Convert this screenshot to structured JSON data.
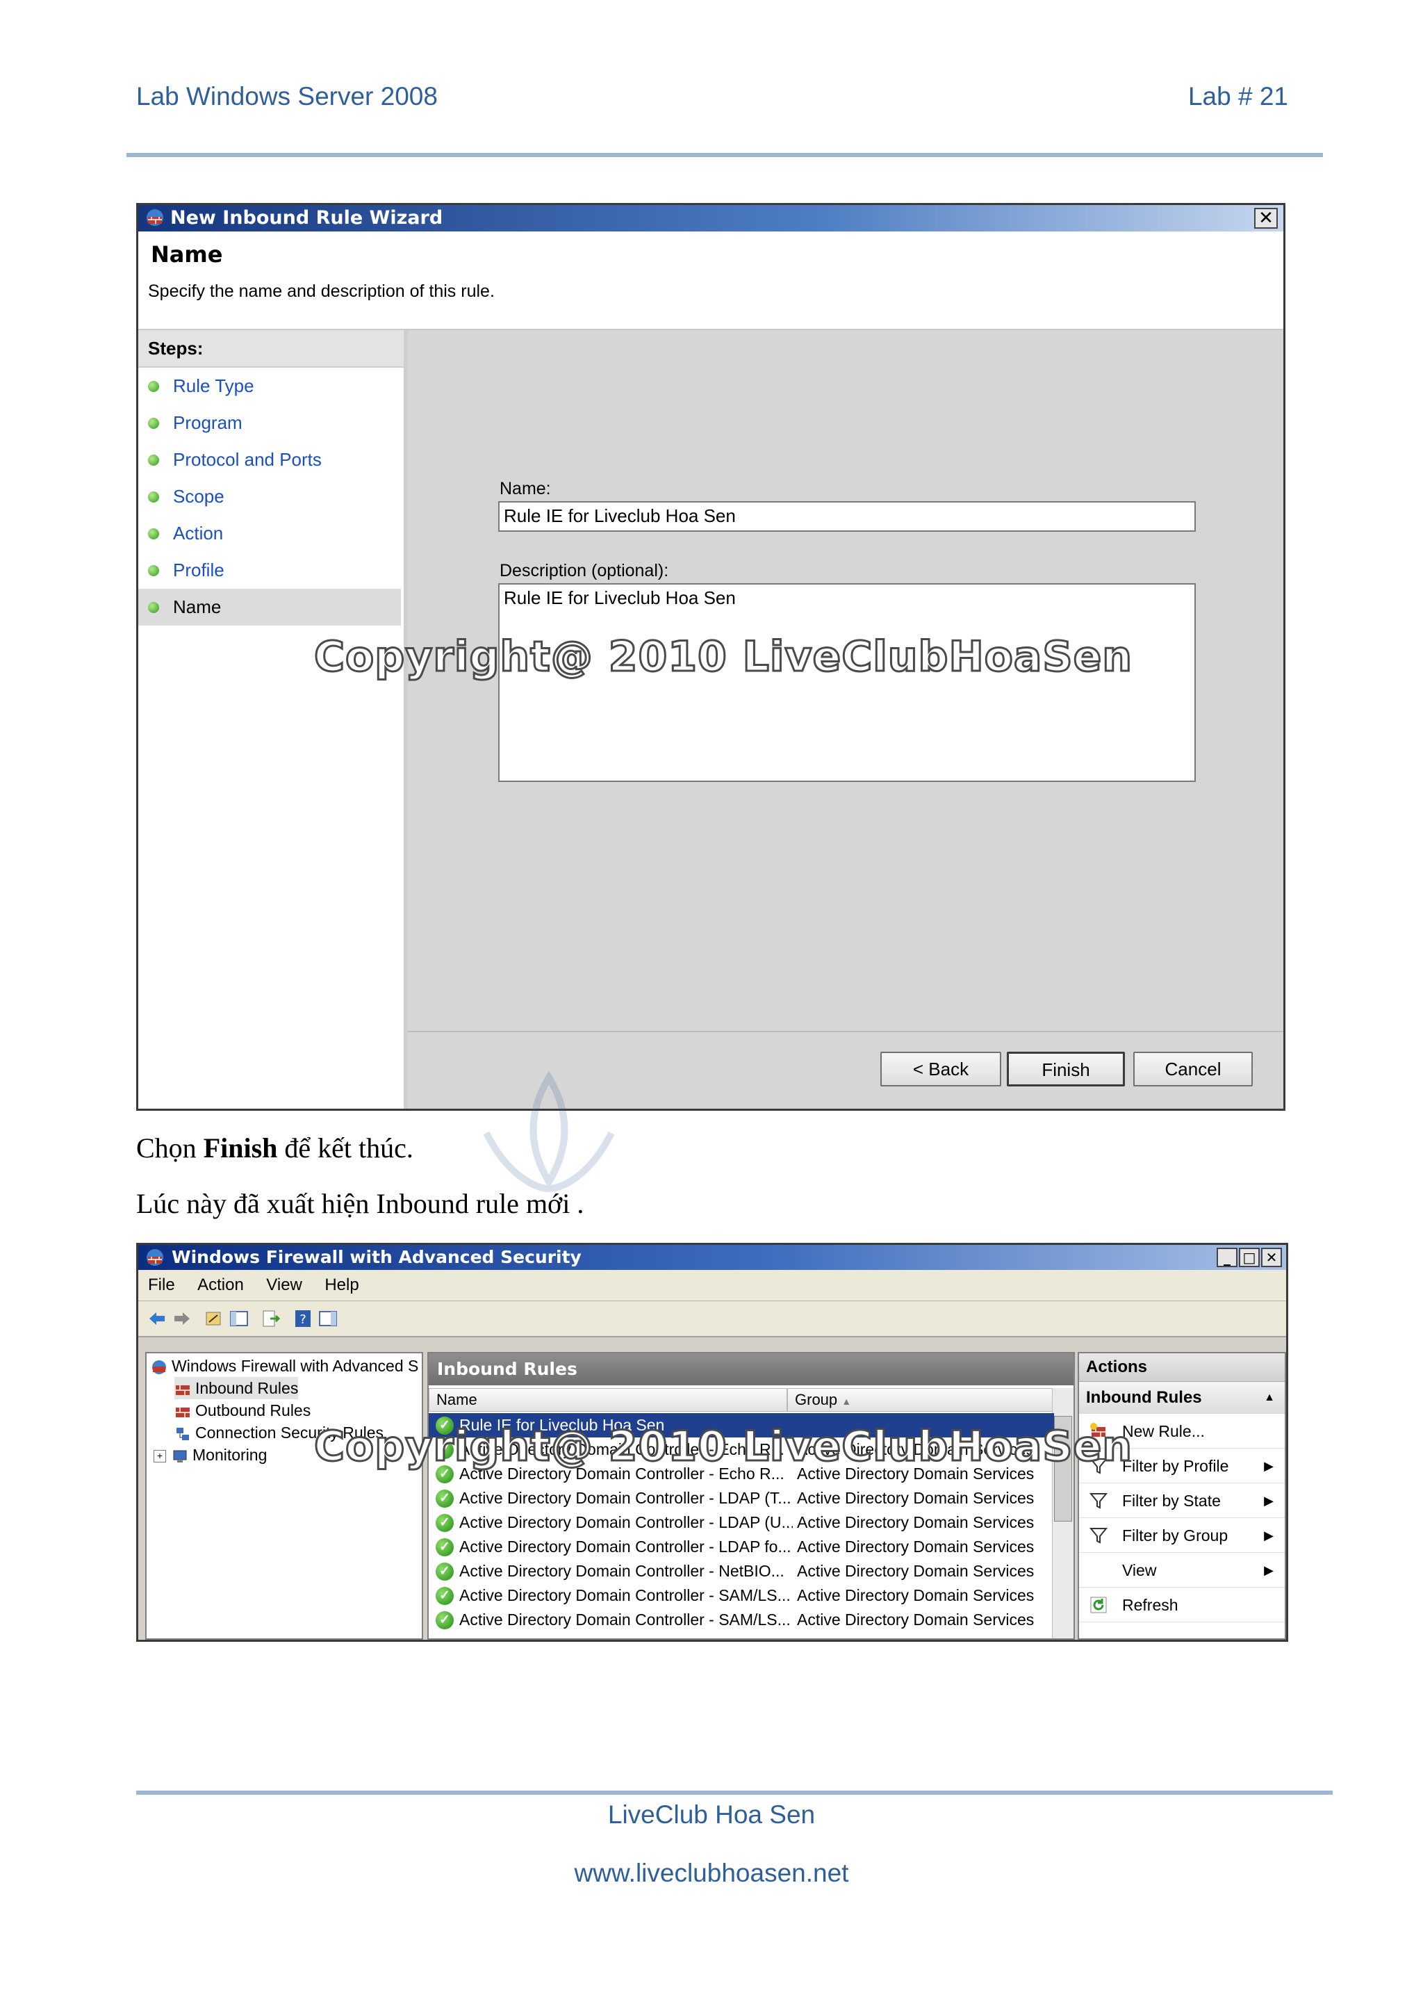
{
  "header": {
    "left": "Lab Windows Server 2008",
    "right": "Lab # 21"
  },
  "wizard": {
    "title": "New Inbound Rule Wizard",
    "close": "✕",
    "heading": "Name",
    "subtitle": "Specify the name and description of this rule.",
    "steps_label": "Steps:",
    "steps": [
      "Rule Type",
      "Program",
      "Protocol and Ports",
      "Scope",
      "Action",
      "Profile",
      "Name"
    ],
    "name_label": "Name:",
    "name_value": "Rule IE for Liveclub Hoa Sen",
    "desc_label": "Description (optional):",
    "desc_value": "Rule IE for Liveclub Hoa Sen",
    "back_label": "< Back",
    "finish_label": "Finish",
    "cancel_label": "Cancel"
  },
  "para1": {
    "before": "Chọn ",
    "bold": "Finish",
    "after": " để kết thúc."
  },
  "para2": "Lúc này đã xuất hiện Inbound rule mới .",
  "firewall": {
    "title": "Windows Firewall with Advanced Security",
    "menus": [
      "File",
      "Action",
      "View",
      "Help"
    ],
    "tree": [
      "Windows Firewall with Advanced S",
      "Inbound Rules",
      "Outbound Rules",
      "Connection Security Rules",
      "Monitoring"
    ],
    "panel_title": "Inbound Rules",
    "col_name": "Name",
    "col_group": "Group",
    "rows": [
      {
        "name": "Rule IE for Liveclub Hoa Sen",
        "group": ""
      },
      {
        "name": "Active Directory Domain Controller - Echo R...",
        "group": "Active Directory Domain Services"
      },
      {
        "name": "Active Directory Domain Controller -  Echo R...",
        "group": "Active Directory Domain Services"
      },
      {
        "name": "Active Directory Domain Controller - LDAP (T...",
        "group": "Active Directory Domain Services"
      },
      {
        "name": "Active Directory Domain Controller - LDAP (U...",
        "group": "Active Directory Domain Services"
      },
      {
        "name": "Active Directory Domain Controller - LDAP fo...",
        "group": "Active Directory Domain Services"
      },
      {
        "name": "Active Directory Domain Controller - NetBIO...",
        "group": "Active Directory Domain Services"
      },
      {
        "name": "Active Directory Domain Controller - SAM/LS...",
        "group": "Active Directory Domain Services"
      },
      {
        "name": "Active Directory Domain Controller - SAM/LS...",
        "group": "Active Directory Domain Services"
      }
    ],
    "actions_title": "Actions",
    "actions_sub": "Inbound Rules",
    "actions": [
      "New Rule...",
      "Filter by Profile",
      "Filter by State",
      "Filter by Group",
      "View",
      "Refresh"
    ]
  },
  "watermark": "Copyright@ 2010 LiveClubHoaSen",
  "footer": {
    "line1": "LiveClub Hoa Sen",
    "line2": "www.liveclubhoasen.net"
  }
}
